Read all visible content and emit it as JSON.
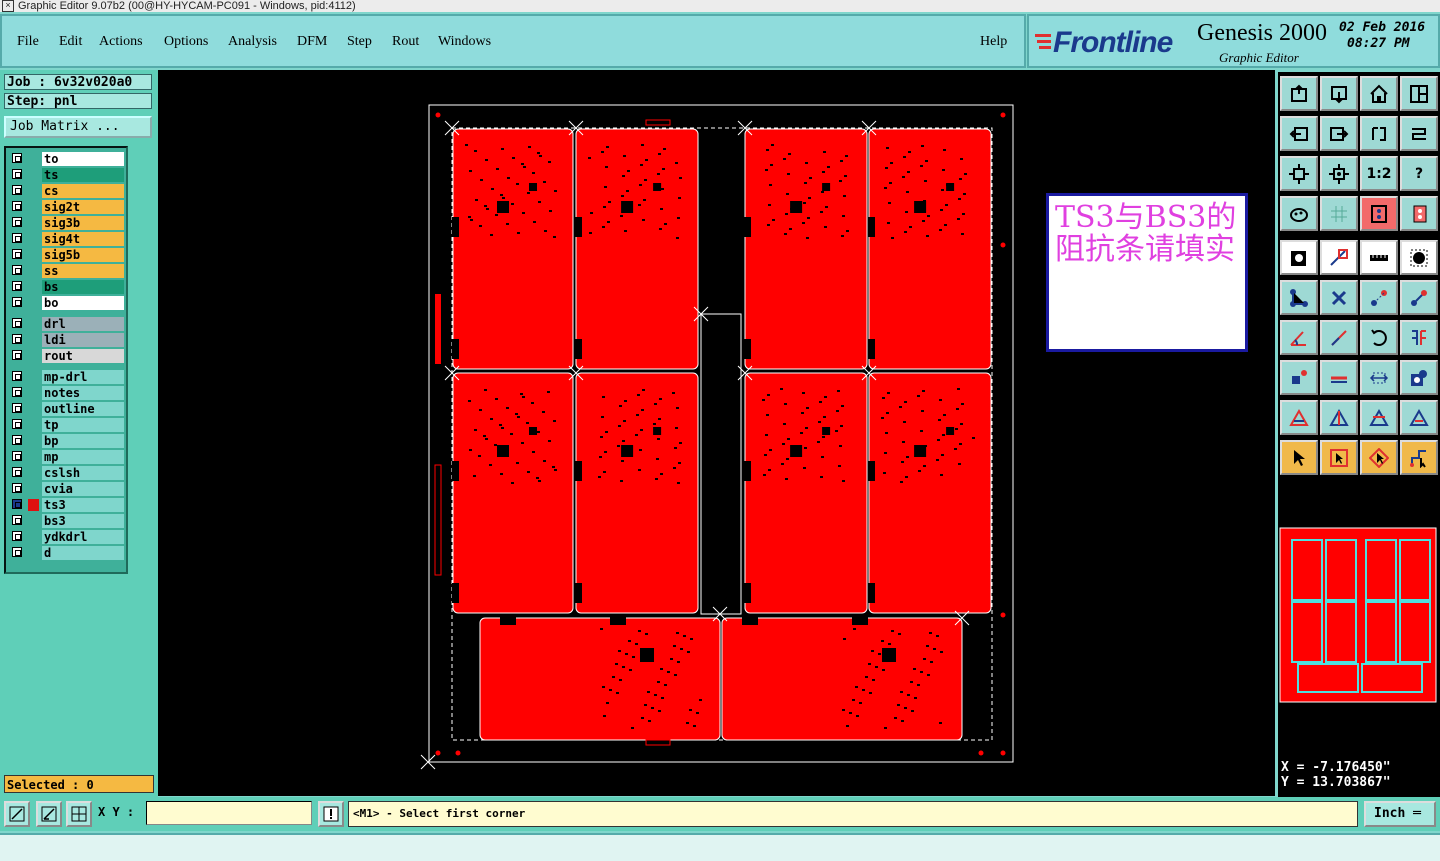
{
  "window": {
    "title": "Graphic Editor 9.07b2 (00@HY-HYCAM-PC091 - Windows, pid:4112)"
  },
  "menu": {
    "file": "File",
    "edit": "Edit",
    "actions": "Actions",
    "options": "Options",
    "analysis": "Analysis",
    "dfm": "DFM",
    "step": "Step",
    "rout": "Rout",
    "windows": "Windows",
    "help": "Help"
  },
  "brand": {
    "logo": "Frontline",
    "product": "Genesis 2000",
    "subtitle": "Graphic Editor",
    "date": "02 Feb 2016",
    "time": "08:27 PM"
  },
  "job": {
    "job_label": "Job : 6v32v020a0",
    "step_label": "Step: pnl",
    "matrix_button": "Job Matrix ..."
  },
  "layers": [
    {
      "name": "to",
      "color": "#ffffff"
    },
    {
      "name": "ts",
      "color": "#1e9e7a"
    },
    {
      "name": "cs",
      "color": "#f5b942"
    },
    {
      "name": "sig2t",
      "color": "#f5b942"
    },
    {
      "name": "sig3b",
      "color": "#f5b942"
    },
    {
      "name": "sig4t",
      "color": "#f5b942"
    },
    {
      "name": "sig5b",
      "color": "#f5b942"
    },
    {
      "name": "ss",
      "color": "#f5b942"
    },
    {
      "name": "bs",
      "color": "#1e9e7a"
    },
    {
      "name": "bo",
      "color": "#ffffff"
    },
    {
      "name": "drl",
      "color": "#9bb0b8"
    },
    {
      "name": "ldi",
      "color": "#9bb0b8"
    },
    {
      "name": "rout",
      "color": "#d8d8d8"
    },
    {
      "name": "mp-drl",
      "color": "#7fd6cc"
    },
    {
      "name": "notes",
      "color": "#7fd6cc"
    },
    {
      "name": "outline",
      "color": "#7fd6cc"
    },
    {
      "name": "tp",
      "color": "#7fd6cc"
    },
    {
      "name": "bp",
      "color": "#7fd6cc"
    },
    {
      "name": "mp",
      "color": "#7fd6cc"
    },
    {
      "name": "cslsh",
      "color": "#7fd6cc"
    },
    {
      "name": "cvia",
      "color": "#7fd6cc"
    },
    {
      "name": "ts3",
      "color": "#7fd6cc",
      "active": true
    },
    {
      "name": "bs3",
      "color": "#7fd6cc"
    },
    {
      "name": "ydkdrl",
      "color": "#7fd6cc"
    },
    {
      "name": "d",
      "color": "#7fd6cc"
    }
  ],
  "selected": "Selected : 0",
  "note": "TS3与BS3的阻抗条请填实",
  "toolbar": {
    "ratio_label": "1:2",
    "help_label": "?"
  },
  "coords": {
    "x": "X = -7.176450\"",
    "y": "Y = 13.703867\""
  },
  "bottom": {
    "xy_label": "X Y :",
    "xy_value": "",
    "message": "<M1> - Select first corner",
    "unit": "Inch"
  },
  "colors": {
    "board": "#ff0000",
    "outline": "#ffffff",
    "accent": "#1a3a8c"
  }
}
